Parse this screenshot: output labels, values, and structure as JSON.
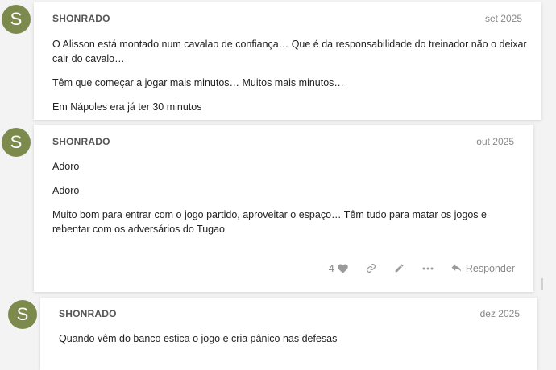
{
  "posts": [
    {
      "avatar_letter": "S",
      "username": "SHONRADO",
      "date": "set 2025",
      "paragraphs": [
        "O Alisson está montado num cavalao de confiança… Que é da responsabilidade do treinador não o deixar cair do cavalo…",
        "Têm que começar a jogar mais minutos… Muitos mais minutos…",
        "Em Nápoles era já ter 30 minutos"
      ]
    },
    {
      "avatar_letter": "S",
      "username": "SHONRADO",
      "date": "out 2025",
      "paragraphs": [
        "Adoro",
        "Adoro",
        "Muito bom para entrar com o jogo partido, aproveitar o espaço… Têm tudo para matar os jogos e rebentar com os adversários do Tugao"
      ],
      "actions": {
        "like_count": "4",
        "reply_label": "Responder"
      }
    },
    {
      "avatar_letter": "S",
      "username": "SHONRADO",
      "date": "dez 2025",
      "paragraphs": [
        "Quando vêm do banco estica o jogo e cria pânico nas defesas"
      ]
    }
  ],
  "colors": {
    "avatar": "#7d8a4e",
    "background": "#f3f3f3",
    "card": "#ffffff",
    "muted_text": "#888888"
  },
  "icons": [
    "heart-icon",
    "link-icon",
    "pencil-icon",
    "more-icon",
    "reply-icon"
  ]
}
